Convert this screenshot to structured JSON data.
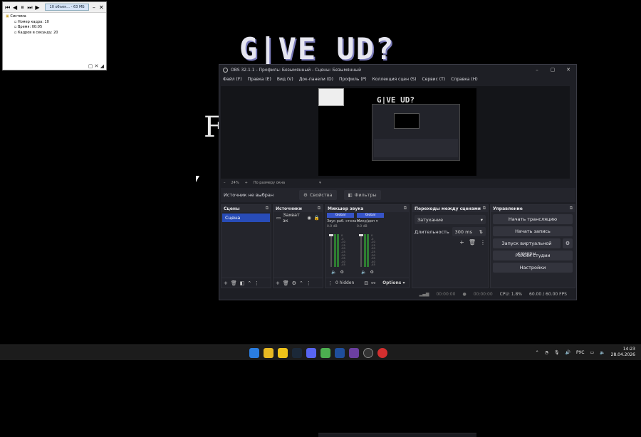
{
  "desktop": {
    "title_art": "G|VE UD?",
    "letter_art": "F"
  },
  "mini_window": {
    "pill": "10 объек... - 63 МБ",
    "tree": {
      "root": "Система",
      "items": [
        "Номер кадра: 10",
        "Время: 00:05",
        "Кадров в секунду: 20"
      ]
    }
  },
  "obs": {
    "title": "OBS 32.1.1 - Профиль: Безымянный - Сцены: Безымянный",
    "menu": [
      "Файл (F)",
      "Правка (E)",
      "Вид (V)",
      "Док-панели (D)",
      "Профиль (P)",
      "Коллекция сцен (S)",
      "Сервис (T)",
      "Справка (H)"
    ],
    "preview_canvas_title": "G|VE UD?",
    "preview_bar": {
      "zoom": "24%",
      "fit": "По размеру окна"
    },
    "source_bar": {
      "label": "Источник не выбран",
      "properties": "Свойства",
      "filters": "Фильтры"
    },
    "scenes": {
      "header": "Сцены",
      "items": [
        "Сцена"
      ]
    },
    "sources": {
      "header": "Источники",
      "items": [
        "Захват эк"
      ]
    },
    "mixer": {
      "header": "Микшер звука",
      "channels": [
        {
          "global": "Global",
          "name": "Звук раб. стола",
          "db": "0.0 dB"
        },
        {
          "global": "Global",
          "name": "Микр/доп",
          "db": "0.0 dB"
        }
      ],
      "scale": [
        "0",
        "-5",
        "-10",
        "-15",
        "-20",
        "-25",
        "-30",
        "-35",
        "-40",
        "-45",
        "-50",
        "-55",
        "-60"
      ],
      "footer_hidden": "0 hidden",
      "footer_options": "Options"
    },
    "transitions": {
      "header": "Переходы между сценами",
      "type": "Затухание",
      "duration_label": "Длительность",
      "duration_value": "300 ms"
    },
    "controls": {
      "header": "Управление",
      "buttons": [
        "Начать трансляцию",
        "Начать запись",
        "Запуск виртуальной камеры",
        "Режим студии",
        "Настройки"
      ]
    },
    "status": {
      "stream_time": "00:00:00",
      "record_time": "00:00:00",
      "cpu": "CPU: 1.8%",
      "fps": "60.00 / 60.00 FPS"
    }
  },
  "taskbar": {
    "lang": "РУС",
    "time": "14:23",
    "date": "28.04.2026"
  }
}
